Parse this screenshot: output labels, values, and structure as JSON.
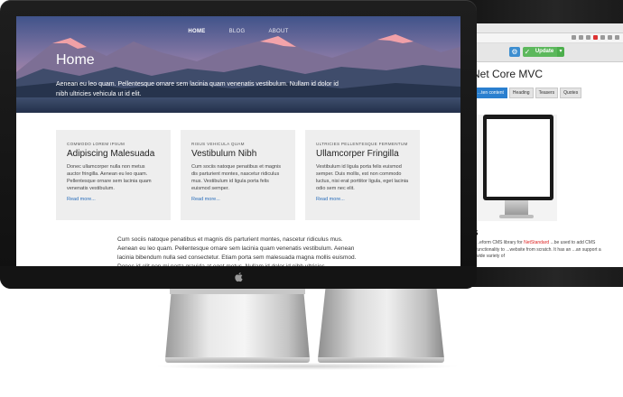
{
  "nav": {
    "items": [
      "HOME",
      "BLOG",
      "ABOUT"
    ]
  },
  "hero": {
    "title": "Home",
    "subtitle": "Aenean eu leo quam. Pellentesque ornare sem lacinia quam venenatis vestibulum. Nullam id dolor id nibh ultricies vehicula ut id elit."
  },
  "cards": [
    {
      "kicker": "COMMODO LOREM IPSUM",
      "title": "Adipiscing Malesuada",
      "body": "Donec ullamcorper nulla non metus auctor fringilla. Aenean eu leo quam. Pellentesque ornare sem lacinia quam venenatis vestibulum.",
      "link": "Read more..."
    },
    {
      "kicker": "RISUS VEHICULA QUAM",
      "title": "Vestibulum Nibh",
      "body": "Cum sociis natoque penatibus et magnis dis parturient montes, nascetur ridiculus mus. Vestibulum id ligula porta felis euismod semper.",
      "link": "Read more..."
    },
    {
      "kicker": "ULTRICIES PELLENTESQUE FERMENTUM",
      "title": "Ullamcorper Fringilla",
      "body": "Vestibulum id ligula porta felis euismod semper. Duis mollis, est non commodo luctus, nisi erat porttitor ligula, eget lacinia odio sem nec elit.",
      "link": "Read more..."
    }
  ],
  "body_text": "Cum sociis natoque penatibus et magnis dis parturient montes, nascetur ridiculus mus. Aenean eu leo quam. Pellentesque ornare sem lacinia quam venenatis vestibulum. Aenean lacinia bibendum nulla sed consectetur. Etiam porta sem malesuada magna mollis euismod. Donec id elit non mi porta gravida at eget metus. Nullam id dolor id nibh ultricies",
  "back_screen": {
    "update_label": "Update",
    "page_title": "Net Core MVC",
    "tabs": [
      "...ten content",
      "Heading",
      "Teasers",
      "Quotes"
    ],
    "heading": "s",
    "text_before": "...eform CMS library for ",
    "text_highlight": "NetStandard",
    "text_after": " ...be used to add CMS functionality to ...website from scratch. It has an ...an support a wide variety of"
  }
}
